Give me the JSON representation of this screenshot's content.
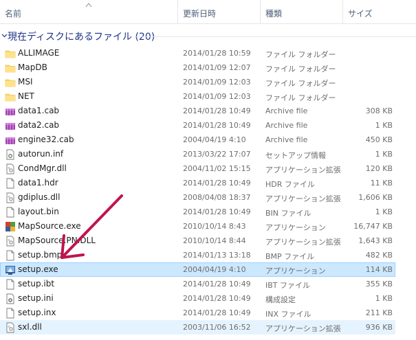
{
  "columns": {
    "name": "名前",
    "modified": "更新日時",
    "type": "種類",
    "size": "サイズ"
  },
  "group": {
    "title": "現在ディスクにあるファイル (20)"
  },
  "colors": {
    "folder": "#ffd764",
    "selected_bg": "#cce8ff",
    "selected_border": "#99d1ff",
    "hover_bg": "#e5f3ff",
    "annotation_arrow": "#c0144c",
    "group_title": "#1e3287"
  },
  "files": [
    {
      "name": "ALLIMAGE",
      "modified": "2014/01/28 10:59",
      "type": "ファイル フォルダー",
      "size": "",
      "icon": "folder-icon"
    },
    {
      "name": "MapDB",
      "modified": "2014/01/09 12:07",
      "type": "ファイル フォルダー",
      "size": "",
      "icon": "folder-icon"
    },
    {
      "name": "MSI",
      "modified": "2014/01/09 12:03",
      "type": "ファイル フォルダー",
      "size": "",
      "icon": "folder-icon"
    },
    {
      "name": "NET",
      "modified": "2014/01/09 12:03",
      "type": "ファイル フォルダー",
      "size": "",
      "icon": "folder-icon"
    },
    {
      "name": "data1.cab",
      "modified": "2014/01/28 10:49",
      "type": "Archive file",
      "size": "308 KB",
      "icon": "archive-icon"
    },
    {
      "name": "data2.cab",
      "modified": "2014/01/28 10:49",
      "type": "Archive file",
      "size": "1 KB",
      "icon": "archive-icon"
    },
    {
      "name": "engine32.cab",
      "modified": "2004/04/19 4:10",
      "type": "Archive file",
      "size": "450 KB",
      "icon": "archive-icon"
    },
    {
      "name": "autorun.inf",
      "modified": "2013/03/22 17:07",
      "type": "セットアップ情報",
      "size": "1 KB",
      "icon": "setup-info-icon"
    },
    {
      "name": "CondMgr.dll",
      "modified": "2004/11/02 15:15",
      "type": "アプリケーション拡張",
      "size": "120 KB",
      "icon": "dll-icon"
    },
    {
      "name": "data1.hdr",
      "modified": "2014/01/28 10:49",
      "type": "HDR ファイル",
      "size": "11 KB",
      "icon": "file-icon"
    },
    {
      "name": "gdiplus.dll",
      "modified": "2008/04/08 18:37",
      "type": "アプリケーション拡張",
      "size": "1,606 KB",
      "icon": "dll-icon"
    },
    {
      "name": "layout.bin",
      "modified": "2014/01/28 10:49",
      "type": "BIN ファイル",
      "size": "1 KB",
      "icon": "file-icon"
    },
    {
      "name": "MapSource.exe",
      "modified": "2010/10/14 8:43",
      "type": "アプリケーション",
      "size": "16,747 KB",
      "icon": "mapsource-app-icon"
    },
    {
      "name": "MapSource.PN.DLL",
      "modified": "2010/10/14 8:44",
      "type": "アプリケーション拡張",
      "size": "1,643 KB",
      "icon": "dll-icon"
    },
    {
      "name": "setup.bmp",
      "modified": "2014/01/13 13:18",
      "type": "BMP ファイル",
      "size": "482 KB",
      "icon": "file-icon"
    },
    {
      "name": "setup.exe",
      "modified": "2004/04/19 4:10",
      "type": "アプリケーション",
      "size": "114 KB",
      "icon": "setup-app-icon",
      "state": "selected"
    },
    {
      "name": "setup.ibt",
      "modified": "2014/01/28 10:49",
      "type": "IBT ファイル",
      "size": "355 KB",
      "icon": "file-icon"
    },
    {
      "name": "setup.ini",
      "modified": "2014/01/28 10:49",
      "type": "構成設定",
      "size": "1 KB",
      "icon": "config-icon"
    },
    {
      "name": "setup.inx",
      "modified": "2014/01/28 10:49",
      "type": "INX ファイル",
      "size": "211 KB",
      "icon": "file-icon"
    },
    {
      "name": "sxl.dll",
      "modified": "2003/11/06 16:52",
      "type": "アプリケーション拡張",
      "size": "936 KB",
      "icon": "dll-icon",
      "state": "hover"
    }
  ]
}
